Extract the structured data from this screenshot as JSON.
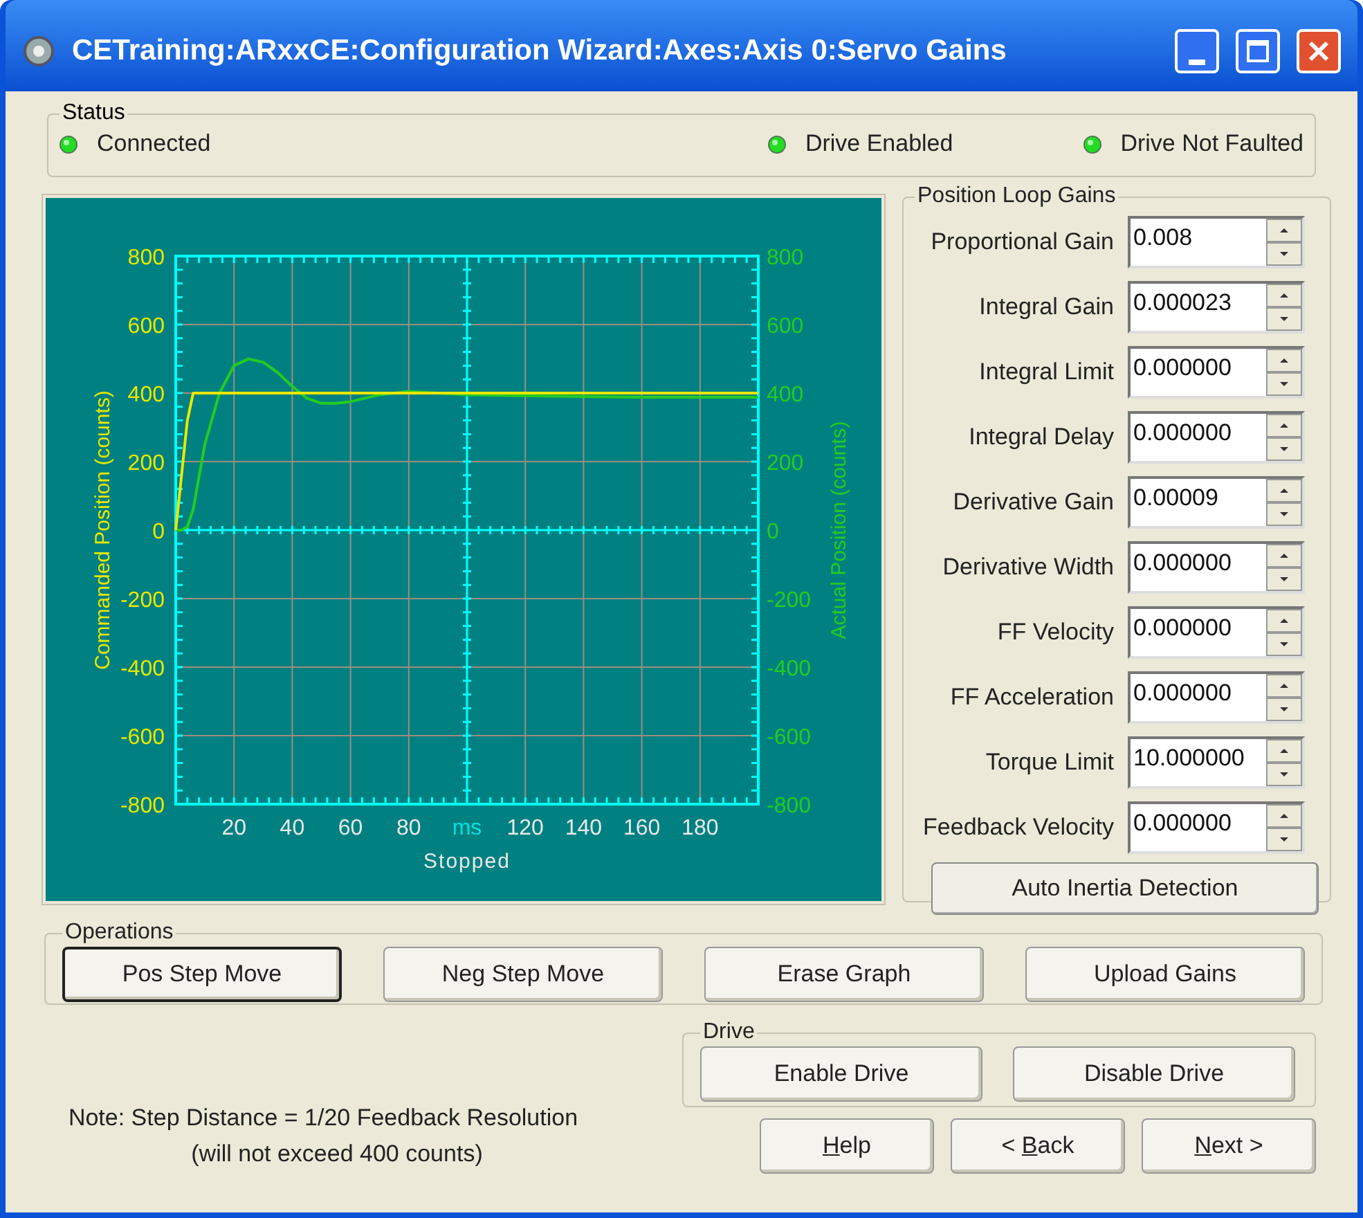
{
  "window": {
    "title": "CETraining:ARxxCE:Configuration Wizard:Axes:Axis 0:Servo Gains"
  },
  "status": {
    "title": "Status",
    "indicators": [
      {
        "label": "Connected",
        "on": true
      },
      {
        "label": "Drive Enabled",
        "on": true
      },
      {
        "label": "Drive Not Faulted",
        "on": true
      }
    ]
  },
  "graph": {
    "status": "Stopped",
    "chart_data": {
      "type": "line",
      "x": [
        0,
        2,
        4,
        6,
        10,
        15,
        20,
        25,
        30,
        35,
        40,
        45,
        50,
        55,
        60,
        65,
        70,
        80,
        90,
        100,
        120,
        140,
        160,
        180,
        200
      ],
      "series": [
        {
          "name": "Commanded Position (counts)",
          "color": "#e8e800",
          "values": [
            0,
            160,
            320,
            400,
            400,
            400,
            400,
            400,
            400,
            400,
            400,
            400,
            400,
            400,
            400,
            400,
            400,
            400,
            400,
            400,
            400,
            400,
            400,
            400,
            400
          ]
        },
        {
          "name": "Actual Position (counts)",
          "color": "#22cc22",
          "values": [
            0,
            0,
            10,
            60,
            250,
            400,
            480,
            500,
            490,
            460,
            420,
            385,
            370,
            370,
            375,
            385,
            395,
            405,
            400,
            395,
            392,
            390,
            388,
            388,
            388
          ]
        }
      ],
      "xlim": [
        0,
        200
      ],
      "ylim": [
        -800,
        800
      ],
      "xticks": [
        20,
        40,
        60,
        80,
        {
          "value": 100,
          "label": "ms"
        },
        120,
        140,
        160,
        180
      ],
      "yticks": [
        -800,
        -600,
        -400,
        -200,
        0,
        200,
        400,
        600,
        800
      ],
      "y2lim": [
        -800,
        800
      ],
      "y2ticks": [
        -800,
        -600,
        -400,
        -200,
        0,
        200,
        400,
        600,
        800
      ],
      "ref_lines": [
        {
          "axis": "y",
          "value": 0
        },
        {
          "axis": "x",
          "value": 100
        }
      ]
    }
  },
  "gains": {
    "title": "Position Loop Gains",
    "fields": [
      {
        "label": "Proportional Gain",
        "value": "0.008"
      },
      {
        "label": "Integral Gain",
        "value": "0.000023"
      },
      {
        "label": "Integral Limit",
        "value": "0.000000"
      },
      {
        "label": "Integral Delay",
        "value": "0.000000"
      },
      {
        "label": "Derivative Gain",
        "value": "0.00009"
      },
      {
        "label": "Derivative Width",
        "value": "0.000000"
      },
      {
        "label": "FF Velocity",
        "value": "0.000000"
      },
      {
        "label": "FF Acceleration",
        "value": "0.000000"
      },
      {
        "label": "Torque Limit",
        "value": "10.000000"
      },
      {
        "label": "Feedback Velocity",
        "value": "0.000000"
      }
    ],
    "button": "Auto Inertia Detection"
  },
  "operations": {
    "title": "Operations",
    "buttons": [
      {
        "label": "Pos Step Move",
        "default": true
      },
      {
        "label": "Neg Step Move",
        "default": false
      },
      {
        "label": "Erase Graph",
        "default": false
      },
      {
        "label": "Upload Gains",
        "default": false
      }
    ]
  },
  "drive": {
    "title": "Drive",
    "buttons": [
      "Enable Drive",
      "Disable Drive"
    ]
  },
  "note": [
    "Note:  Step Distance = 1/20 Feedback Resolution",
    "(will not exceed 400 counts)"
  ],
  "nav_buttons": [
    {
      "underlined": "H",
      "suffix": "elp"
    },
    {
      "prefix": "< ",
      "underlined": "B",
      "suffix": "ack"
    },
    {
      "underlined": "N",
      "suffix": "ext >"
    }
  ]
}
